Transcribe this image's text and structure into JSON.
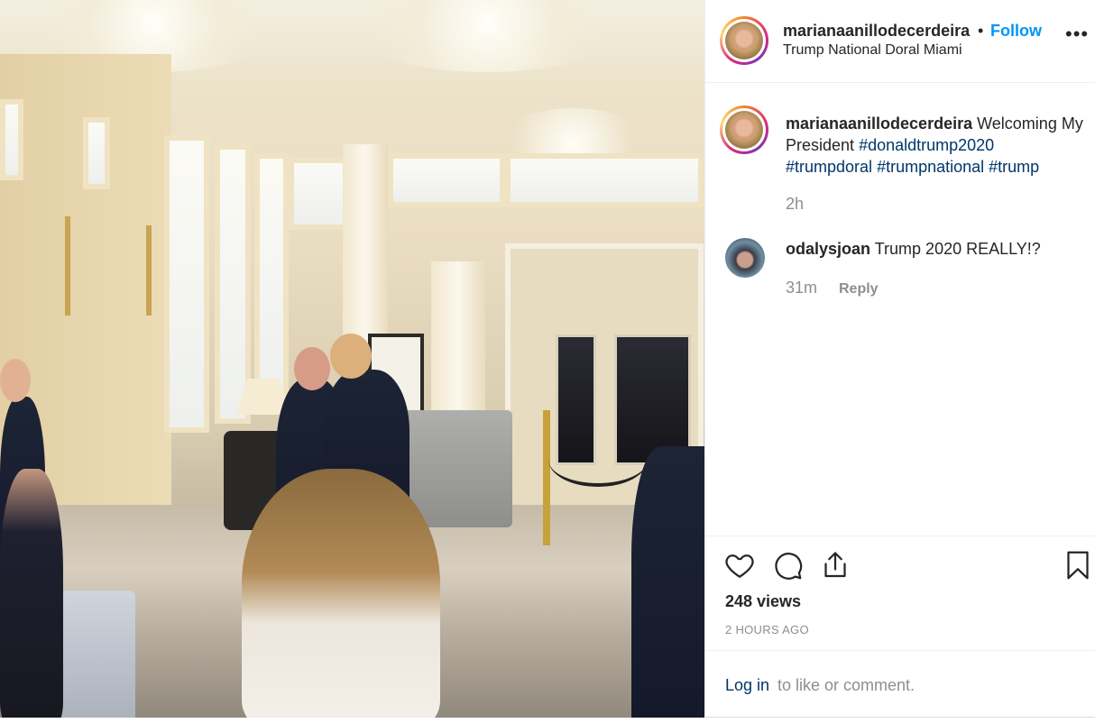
{
  "post": {
    "username": "marianaanillodecerdeira",
    "follow_label": "Follow",
    "dot": "•",
    "location": "Trump National Doral Miami",
    "more_label": "•••"
  },
  "caption": {
    "username": "marianaanillodecerdeira",
    "text": "Welcoming My President",
    "hashtags": [
      "#donaldtrump2020",
      "#trumpdoral",
      "#trumpnational",
      "#trump"
    ],
    "time": "2h"
  },
  "comments": [
    {
      "username": "odalysjoan",
      "text": "Trump 2020 REALLY!?",
      "time": "31m",
      "reply_label": "Reply"
    }
  ],
  "stats": {
    "views": "248 views",
    "posted_ago": "2 HOURS AGO"
  },
  "footer": {
    "login_label": "Log in",
    "login_rest": "to like or comment."
  },
  "icons": {
    "like": "heart-icon",
    "comment": "comment-bubble-icon",
    "share": "share-icon",
    "save": "bookmark-icon",
    "more": "more-options-icon"
  },
  "colors": {
    "link_blue": "#0095f6",
    "hashtag": "#00376b",
    "muted": "#8e8e8e"
  }
}
